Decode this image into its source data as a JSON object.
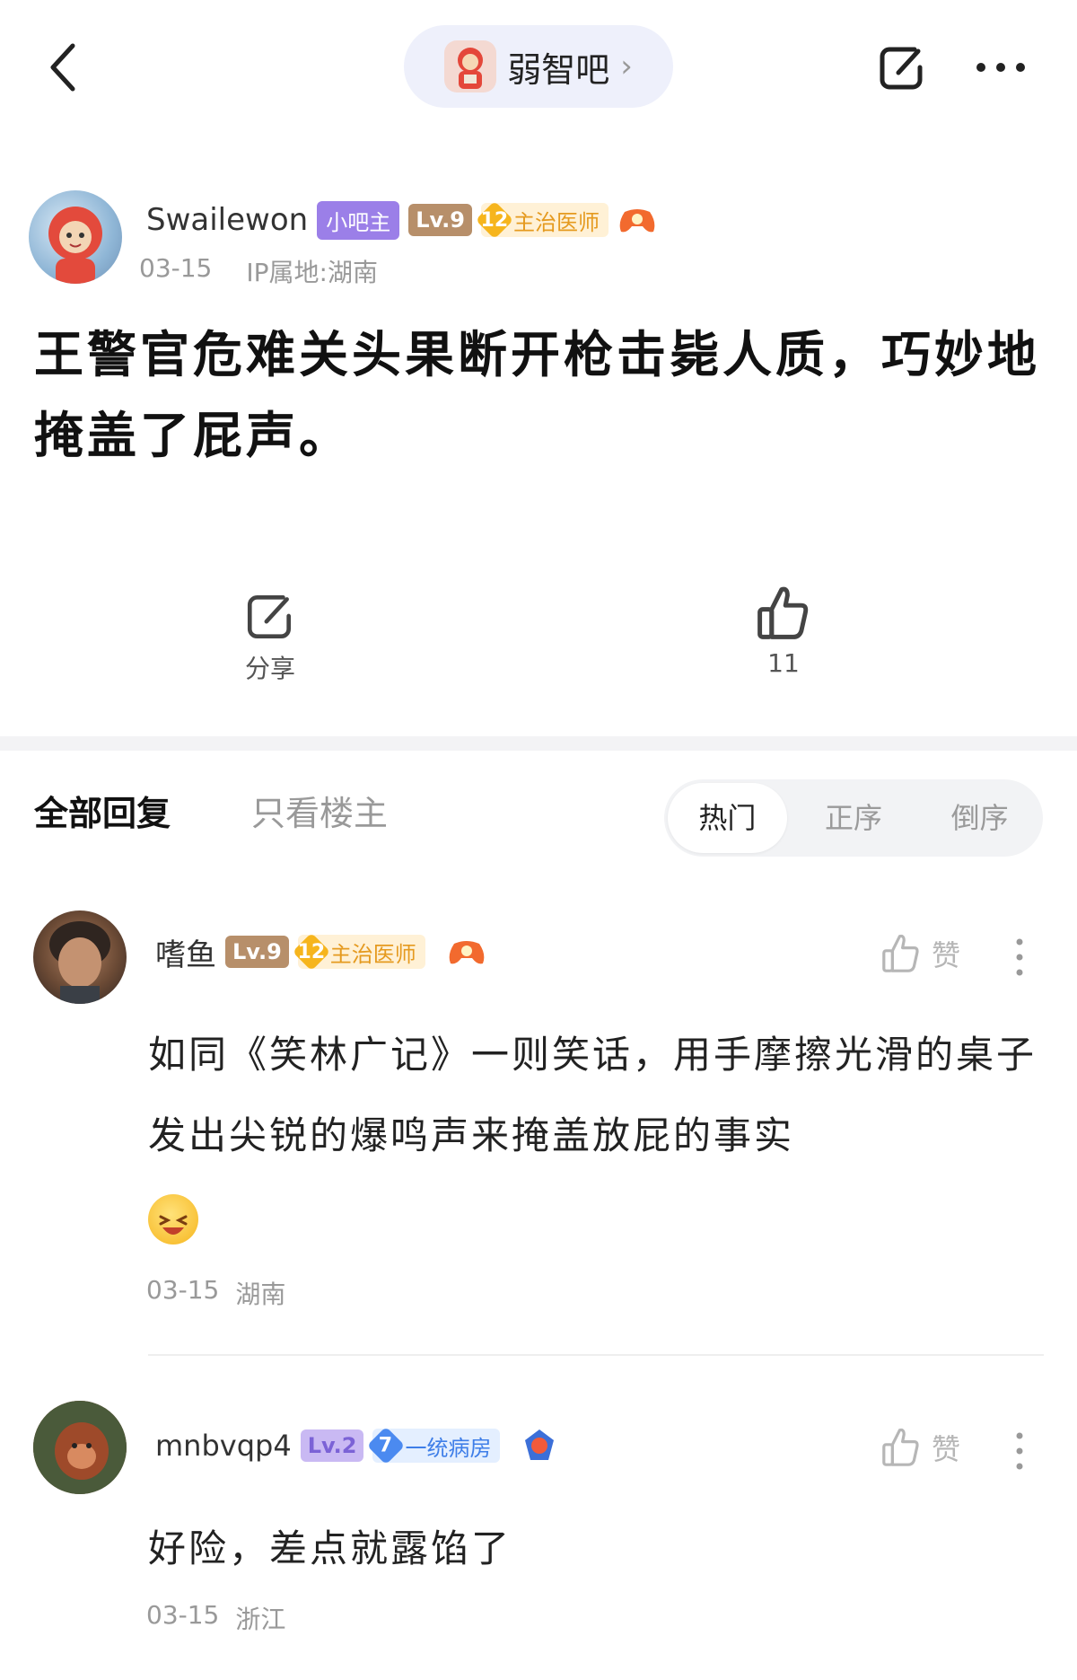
{
  "top_bar": {
    "forum_name": "弱智吧",
    "forum_chevron": "›"
  },
  "post": {
    "author": "Swailewon",
    "role_badge": "小吧主",
    "level_badge": "Lv.9",
    "rank_number": "12",
    "rank_title": "主治医师",
    "date": "03-15",
    "ip_location": "IP属地:湖南",
    "title": "王警官危难关头果断开枪击毙人质，巧妙地掩盖了屁声。",
    "share_label": "分享",
    "like_count": "11"
  },
  "tabs": {
    "all_replies": "全部回复",
    "owner_only": "只看楼主",
    "sort_options": [
      "热门",
      "正序",
      "倒序"
    ]
  },
  "comments": [
    {
      "author": "嗜鱼",
      "level_badge": "Lv.9",
      "rank_number": "12",
      "rank_title": "主治医师",
      "like_label": "赞",
      "text": "如同《笑林广记》一则笑话，用手摩擦光滑的桌子发出尖锐的爆鸣声来掩盖放屁的事实",
      "date": "03-15",
      "location": "湖南"
    },
    {
      "author": "mnbvqp4",
      "level_badge": "Lv.2",
      "rank_number": "7",
      "rank_title": "一统病房",
      "like_label": "赞",
      "text": "好险，差点就露馅了",
      "date": "03-15",
      "location": "浙江"
    }
  ]
}
